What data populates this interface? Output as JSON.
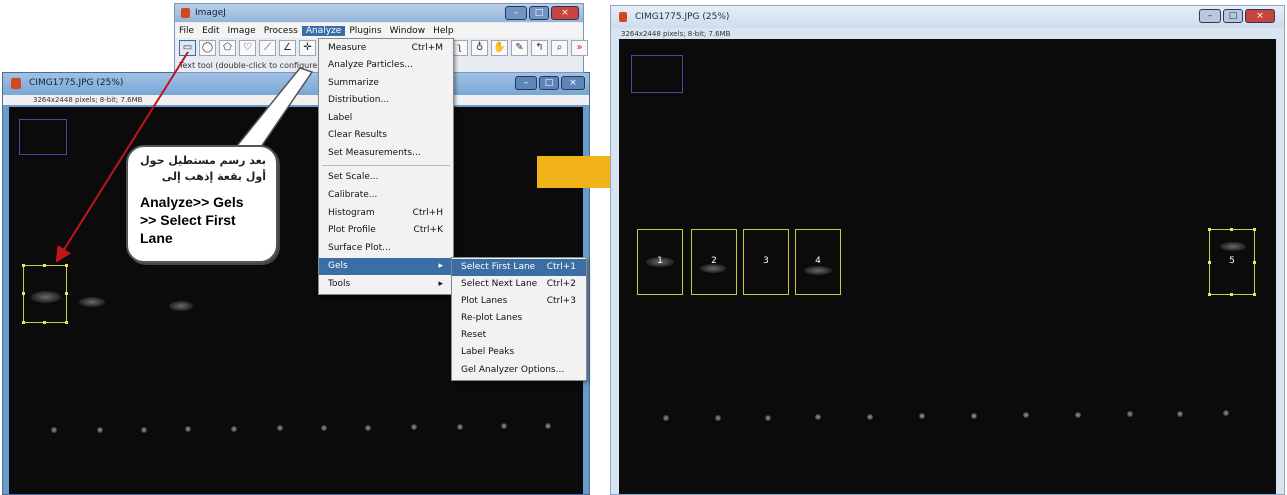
{
  "imagej": {
    "title": "ImageJ",
    "menus": [
      "File",
      "Edit",
      "Image",
      "Process",
      "Analyze",
      "Plugins",
      "Window",
      "Help"
    ],
    "active_menu": "Analyze",
    "status": "Text tool (double-click to configure)"
  },
  "left_window": {
    "title": "CIMG1775.JPG (25%)",
    "info": "3264x2448 pixels; 8-bit; 7.6MB"
  },
  "analyze_menu": {
    "items": [
      {
        "label": "Measure",
        "shortcut": "Ctrl+M"
      },
      {
        "label": "Analyze Particles...",
        "shortcut": ""
      },
      {
        "label": "Summarize",
        "shortcut": ""
      },
      {
        "label": "Distribution...",
        "shortcut": ""
      },
      {
        "label": "Label",
        "shortcut": ""
      },
      {
        "label": "Clear Results",
        "shortcut": ""
      },
      {
        "label": "Set Measurements...",
        "shortcut": ""
      },
      {
        "label": "Set Scale...",
        "shortcut": ""
      },
      {
        "label": "Calibrate...",
        "shortcut": ""
      },
      {
        "label": "Histogram",
        "shortcut": "Ctrl+H"
      },
      {
        "label": "Plot Profile",
        "shortcut": "Ctrl+K"
      },
      {
        "label": "Surface Plot...",
        "shortcut": ""
      },
      {
        "label": "Gels",
        "shortcut": ""
      },
      {
        "label": "Tools",
        "shortcut": ""
      }
    ]
  },
  "gels_menu": {
    "items": [
      {
        "label": "Select First Lane",
        "shortcut": "Ctrl+1"
      },
      {
        "label": "Select Next Lane",
        "shortcut": "Ctrl+2"
      },
      {
        "label": "Plot Lanes",
        "shortcut": "Ctrl+3"
      },
      {
        "label": "Re-plot Lanes",
        "shortcut": ""
      },
      {
        "label": "Reset",
        "shortcut": ""
      },
      {
        "label": "Label Peaks",
        "shortcut": ""
      },
      {
        "label": "Gel Analyzer Options...",
        "shortcut": ""
      }
    ]
  },
  "callout": {
    "arabic_line1": "بعد رسم مستطيل حول",
    "arabic_line2": "أول بقعة إذهب إلى",
    "english_line1": "Analyze>> Gels",
    "english_line2": ">> Select First",
    "english_line3": "Lane"
  },
  "right_window": {
    "title": "CIMG1775.JPG (25%)",
    "info": "3264x2448 pixels; 8-bit; 7.6MB",
    "lanes": [
      "1",
      "2",
      "3",
      "4",
      "5"
    ]
  },
  "colors": {
    "arrow_red": "#c0141c",
    "arrow_orange": "#f2b318",
    "highlight": "#3a6ea5",
    "lane_box": "#c8c84a"
  }
}
